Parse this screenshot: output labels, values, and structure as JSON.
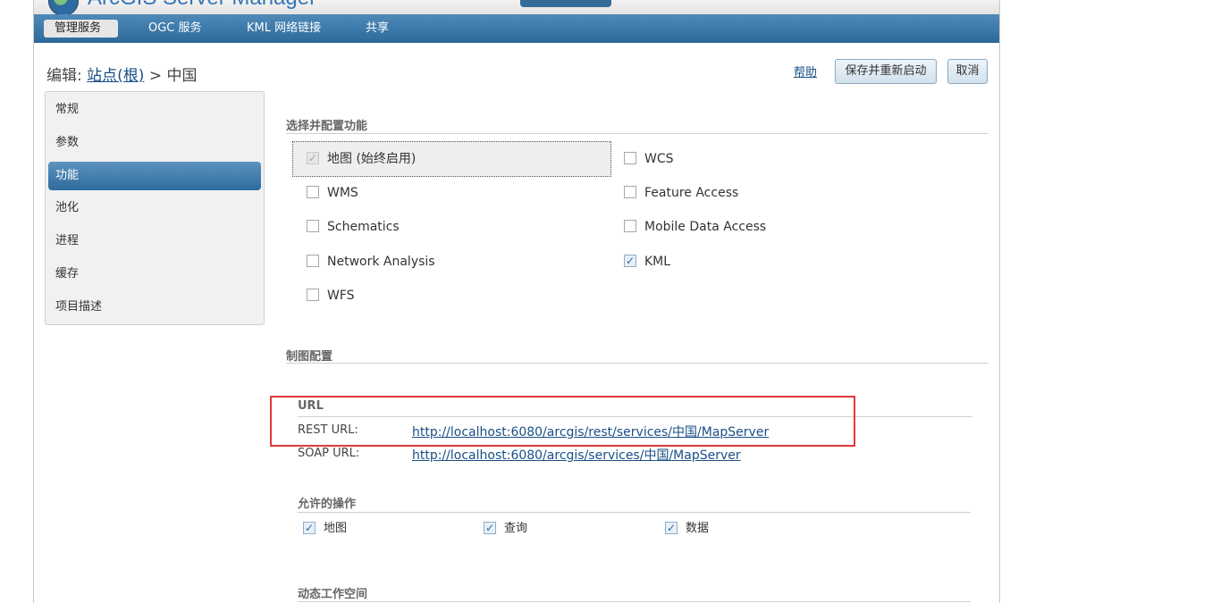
{
  "app": {
    "title": "ArcGIS Server Manager"
  },
  "nav": {
    "items": [
      {
        "label": "管理服务",
        "active": true
      },
      {
        "label": "OGC 服务"
      },
      {
        "label": "KML 网络链接"
      },
      {
        "label": "共享"
      }
    ]
  },
  "page": {
    "edit_prefix": "编辑:",
    "breadcrumb_root": "站点(根)",
    "breadcrumb_sep": ">",
    "breadcrumb_current": "中国",
    "help": "帮助",
    "save": "保存并重新启动",
    "cancel": "取消"
  },
  "sidebar": {
    "items": [
      "常规",
      "参数",
      "功能",
      "池化",
      "进程",
      "缓存",
      "项目描述"
    ],
    "active_index": 2
  },
  "capabilities": {
    "title": "选择并配置功能",
    "items": [
      {
        "label": "地图 (始终启用)",
        "checked": true,
        "disabled": true
      },
      {
        "label": "WCS",
        "checked": false
      },
      {
        "label": "WMS",
        "checked": false
      },
      {
        "label": "Feature Access",
        "checked": false
      },
      {
        "label": "Schematics",
        "checked": false
      },
      {
        "label": "Mobile Data Access",
        "checked": false
      },
      {
        "label": "Network Analysis",
        "checked": false
      },
      {
        "label": "KML",
        "checked": true
      },
      {
        "label": "WFS",
        "checked": false
      }
    ]
  },
  "mapping": {
    "title": "制图配置"
  },
  "url": {
    "title": "URL",
    "rest_label": "REST URL:",
    "rest_value": "http://localhost:6080/arcgis/rest/services/中国/MapServer",
    "soap_label": "SOAP URL:",
    "soap_value": "http://localhost:6080/arcgis/services/中国/MapServer"
  },
  "operations": {
    "title": "允许的操作",
    "items": [
      {
        "label": "地图",
        "checked": true
      },
      {
        "label": "查询",
        "checked": true
      },
      {
        "label": "数据",
        "checked": true
      }
    ]
  },
  "workspace": {
    "title": "动态工作空间"
  },
  "colors": {
    "nav": "#2c6a9a",
    "accent": "#3576b4",
    "highlight": "#e03a3a",
    "link": "#1a4f86"
  },
  "icons": {
    "checked": "✓",
    "logo": "globe-logo-icon"
  }
}
